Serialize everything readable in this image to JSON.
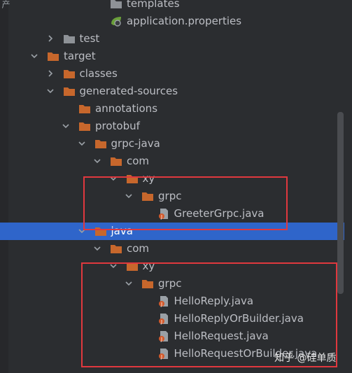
{
  "gutter_label": "产",
  "tree": [
    {
      "label": "templates",
      "icon": "folder-gray",
      "depth": 5,
      "expand": "none"
    },
    {
      "label": "application.properties",
      "icon": "spring-properties-icon",
      "depth": 5,
      "expand": "none"
    },
    {
      "label": "test",
      "icon": "folder-gray",
      "depth": 2,
      "expand": "collapsed"
    },
    {
      "label": "target",
      "icon": "folder-orange",
      "depth": 1,
      "expand": "expanded"
    },
    {
      "label": "classes",
      "icon": "folder-orange",
      "depth": 2,
      "expand": "collapsed"
    },
    {
      "label": "generated-sources",
      "icon": "folder-orange",
      "depth": 2,
      "expand": "expanded"
    },
    {
      "label": "annotations",
      "icon": "folder-orange",
      "depth": 3,
      "expand": "none"
    },
    {
      "label": "protobuf",
      "icon": "folder-orange",
      "depth": 3,
      "expand": "expanded"
    },
    {
      "label": "grpc-java",
      "icon": "folder-orange",
      "depth": 4,
      "expand": "expanded"
    },
    {
      "label": "com",
      "icon": "folder-orange",
      "depth": 5,
      "expand": "expanded"
    },
    {
      "label": "xy",
      "icon": "folder-orange",
      "depth": 6,
      "expand": "expanded"
    },
    {
      "label": "grpc",
      "icon": "folder-orange",
      "depth": 7,
      "expand": "expanded"
    },
    {
      "label": "GreeterGrpc.java",
      "icon": "java-file",
      "depth": 8,
      "expand": "none"
    },
    {
      "label": "java",
      "icon": "folder-orange",
      "depth": 4,
      "expand": "expanded",
      "selected": true
    },
    {
      "label": "com",
      "icon": "folder-orange",
      "depth": 5,
      "expand": "expanded"
    },
    {
      "label": "xy",
      "icon": "folder-orange",
      "depth": 6,
      "expand": "expanded"
    },
    {
      "label": "grpc",
      "icon": "folder-orange",
      "depth": 7,
      "expand": "expanded"
    },
    {
      "label": "HelloReply.java",
      "icon": "java-file",
      "depth": 8,
      "expand": "none"
    },
    {
      "label": "HelloReplyOrBuilder.java",
      "icon": "java-file",
      "depth": 8,
      "expand": "none"
    },
    {
      "label": "HelloRequest.java",
      "icon": "java-file",
      "depth": 8,
      "expand": "none"
    },
    {
      "label": "HelloRequestOrBuilder.java",
      "icon": "java-file",
      "depth": 8,
      "expand": "none"
    }
  ],
  "watermark": "知乎 @硅单质",
  "colors": {
    "background": "#2b2d30",
    "selection": "#2f65ca",
    "folder_orange": "#c7672c",
    "folder_gray": "#8e9297",
    "highlight_box": "#e0383e"
  }
}
